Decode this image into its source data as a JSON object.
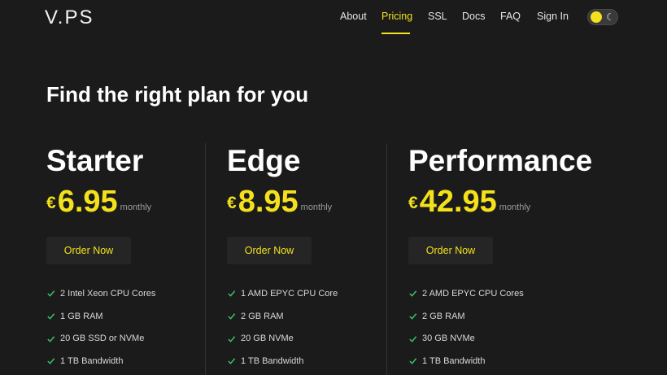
{
  "nav": {
    "logo": "V.PS",
    "links": [
      "About",
      "Pricing",
      "SSL",
      "Docs",
      "FAQ",
      "Sign In"
    ],
    "active": "Pricing",
    "theme_toggle_icons": [
      "sun-icon",
      "moon-icon"
    ]
  },
  "headline": "Find the right plan for you",
  "plans": [
    {
      "name": "Starter",
      "currency": "€",
      "amount": "6.95",
      "period": "monthly",
      "cta": "Order Now",
      "features": [
        "2 Intel Xeon CPU Cores",
        "1 GB RAM",
        "20 GB SSD or NVMe",
        "1 TB Bandwidth"
      ]
    },
    {
      "name": "Edge",
      "currency": "€",
      "amount": "8.95",
      "period": "monthly",
      "cta": "Order Now",
      "features": [
        "1 AMD EPYC CPU Core",
        "2 GB RAM",
        "20 GB NVMe",
        "1 TB Bandwidth"
      ]
    },
    {
      "name": "Performance",
      "currency": "€",
      "amount": "42.95",
      "period": "monthly",
      "cta": "Order Now",
      "features": [
        "2 AMD EPYC CPU Cores",
        "2 GB RAM",
        "30 GB NVMe",
        "1 TB Bandwidth"
      ]
    }
  ],
  "colors": {
    "background": "#1b1b1b",
    "accent": "#f4e11c",
    "check": "#3ec46d",
    "button_bg": "#252525"
  }
}
